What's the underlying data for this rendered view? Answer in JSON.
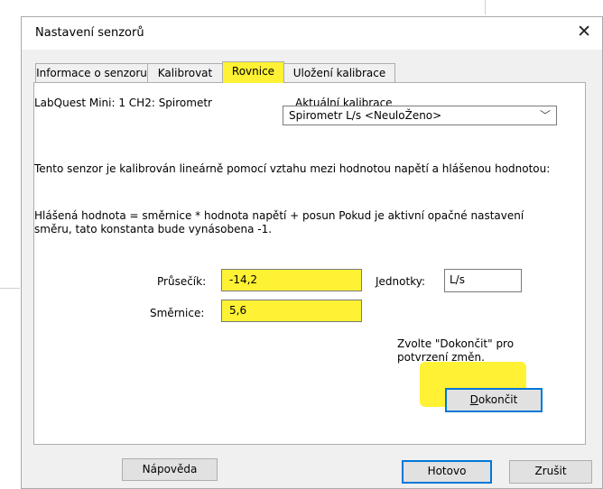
{
  "dialog": {
    "title": "Nastavení senzorů",
    "close_glyph": "✕"
  },
  "tabs": [
    {
      "label": "Informace o senzoru"
    },
    {
      "label": "Kalibrovat"
    },
    {
      "label": "Rovnice"
    },
    {
      "label": "Uložení kalibrace"
    }
  ],
  "panel": {
    "sensor_label": "LabQuest Mini: 1 CH2: Spirometr",
    "calibration_label_first": "A",
    "calibration_label_rest": "ktuální kalibrace",
    "calibration_value": "Spirometr L/s <NeuloŽeno>",
    "description": "Tento senzor je kalibrován lineárně pomocí vztahu mezi hodnotou napětí a hlášenou hodnotou:",
    "formula": "Hlášená hodnota = směrnice * hodnota napětí + posun  Pokud je aktivní opačné nastavení směru, tato konstanta bude vynásobena -1.",
    "intercept_label": "Průsečík:",
    "intercept_value": "-14,2",
    "units_label_first": "J",
    "units_label_rest": "ednotky:",
    "units_value": "L/s",
    "slope_label": "Směrnice:",
    "slope_value": "5,6",
    "finish_hint": "Zvolte \"Dokončit\" pro potvrzení změn.",
    "finish_button_first": "D",
    "finish_button_rest": "okončit"
  },
  "footer": {
    "help_label": "Nápověda",
    "done_label": "Hotovo",
    "cancel_label": "Zrušit"
  },
  "colors": {
    "highlight": "#fff133",
    "accent": "#0078d7"
  }
}
